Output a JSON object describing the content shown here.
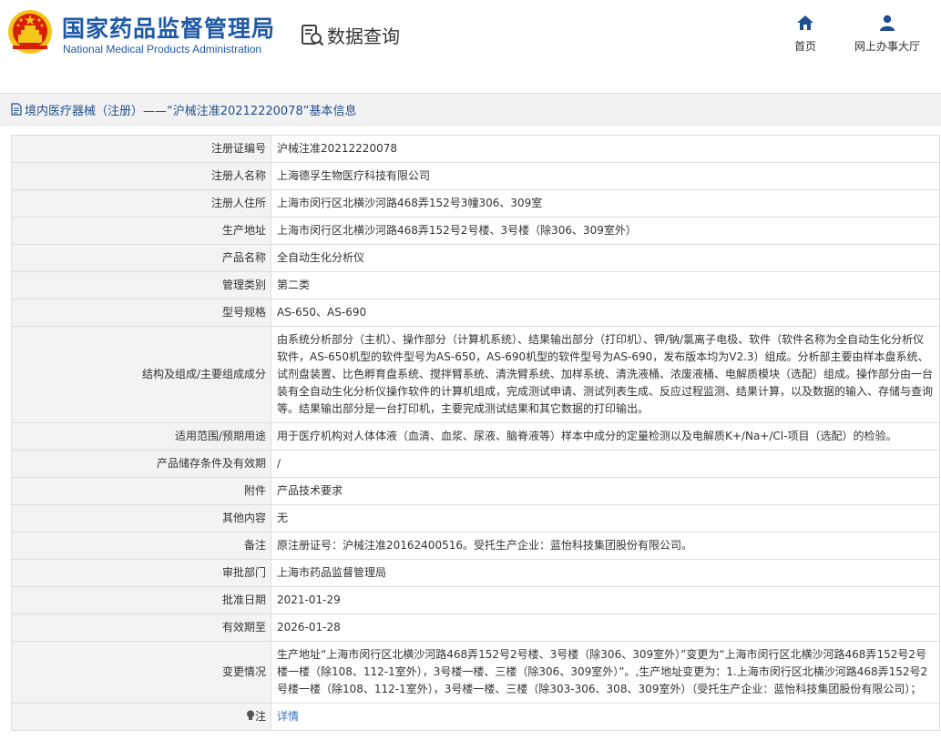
{
  "header": {
    "brand_cn": "国家药品监督管理局",
    "brand_en": "National Medical Products Administration",
    "query_label": "数据查询",
    "nav": [
      {
        "label": "首页",
        "icon": "home-icon"
      },
      {
        "label": "网上办事大厅",
        "icon": "user-icon"
      }
    ],
    "colors": {
      "brand": "#1f5aa6",
      "emblem_red": "#d81e06",
      "emblem_gold": "#f5c518"
    }
  },
  "breadcrumb": "境内医疗器械（注册）——“沪械注准20212220078”基本信息",
  "rows": [
    {
      "label": "注册证编号",
      "value": "沪械注准20212220078"
    },
    {
      "label": "注册人名称",
      "value": "上海德孚生物医疗科技有限公司"
    },
    {
      "label": "注册人住所",
      "value": "上海市闵行区北横沙河路468弄152号3幢306、309室"
    },
    {
      "label": "生产地址",
      "value": "上海市闵行区北横沙河路468弄152号2号楼、3号楼（除306、309室外）"
    },
    {
      "label": "产品名称",
      "value": "全自动生化分析仪"
    },
    {
      "label": "管理类别",
      "value": "第二类"
    },
    {
      "label": "型号规格",
      "value": "AS-650、AS-690"
    },
    {
      "label": "结构及组成/主要组成成分",
      "value": "由系统分析部分（主机）、操作部分（计算机系统）、结果输出部分（打印机）、钾/钠/氯离子电极、软件（软件名称为全自动生化分析仪软件，AS-650机型的软件型号为AS-650，AS-690机型的软件型号为AS-690，发布版本均为V2.3）组成。分析部主要由样本盘系统、试剂盘装置、比色孵育盘系统、搅拌臂系统、清洗臂系统、加样系统、清洗液桶、浓废液桶、电解质模块（选配）组成。操作部分由一台装有全自动生化分析仪操作软件的计算机组成，完成测试申请、测试列表生成、反应过程监测、结果计算，以及数据的输入、存储与查询等。结果输出部分是一台打印机，主要完成测试结果和其它数据的打印输出。"
    },
    {
      "label": "适用范围/预期用途",
      "value": "用于医疗机构对人体体液（血清、血浆、尿液、脑脊液等）样本中成分的定量检测以及电解质K+/Na+/Cl-项目（选配）的检验。"
    },
    {
      "label": "产品储存条件及有效期",
      "value": "/"
    },
    {
      "label": "附件",
      "value": "产品技术要求"
    },
    {
      "label": "其他内容",
      "value": "无"
    },
    {
      "label": "备注",
      "value": "原注册证号：沪械注准20162400516。受托生产企业：蓝怡科技集团股份有限公司。"
    },
    {
      "label": "审批部门",
      "value": "上海市药品监督管理局"
    },
    {
      "label": "批准日期",
      "value": "2021-01-29"
    },
    {
      "label": "有效期至",
      "value": "2026-01-28"
    },
    {
      "label": "变更情况",
      "value": "生产地址“上海市闵行区北横沙河路468弄152号2号楼、3号楼（除306、309室外）”变更为“上海市闵行区北横沙河路468弄152号2号楼一楼（除108、112-1室外），3号楼一楼、三楼（除306、309室外）”。,生产地址变更为：1.上海市闵行区北横沙河路468弄152号2号楼一楼（除108、112-1室外），3号楼一楼、三楼（除303-306、308、309室外）（受托生产企业：蓝怡科技集团股份有限公司）；"
    }
  ],
  "note_row": {
    "label": "注",
    "icon": "bulb-icon",
    "link": "详情"
  }
}
